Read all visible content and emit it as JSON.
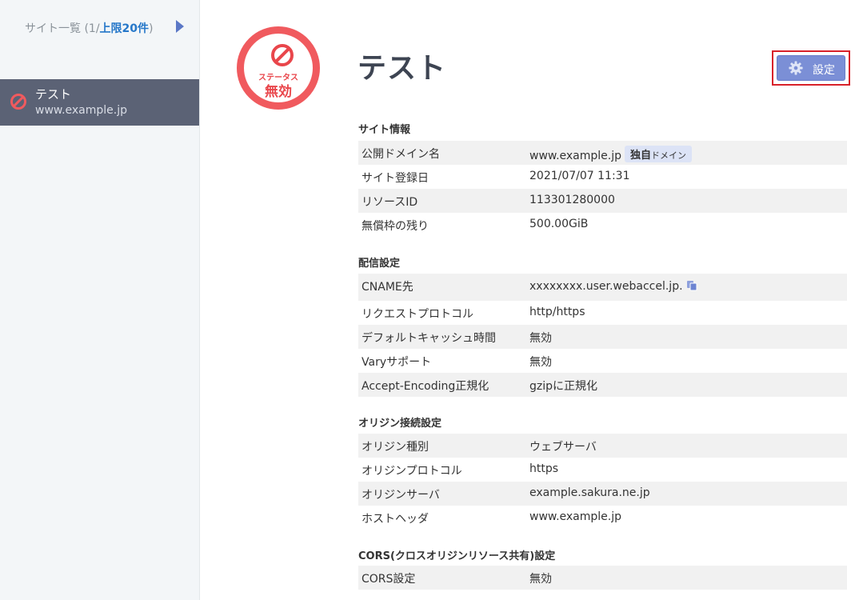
{
  "sidebar": {
    "count_prefix": "サイト一覧 (1/",
    "count_limit": "上限20件",
    "count_suffix": ")",
    "items": [
      {
        "name": "テスト",
        "domain": "www.example.jp",
        "status_icon": "ban-icon"
      }
    ]
  },
  "status": {
    "label": "ステータス",
    "value": "無効",
    "color": "#f05a5e"
  },
  "title": "テスト",
  "toolbar": {
    "settings_label": "設定",
    "settings_icon": "gear-icon"
  },
  "sections": {
    "site_info": {
      "title": "サイト情報",
      "rows": [
        {
          "key": "公開ドメイン名",
          "value": "www.example.jp",
          "badge_main": "独自",
          "badge_sub": "ドメイン"
        },
        {
          "key": "サイト登録日",
          "value": "2021/07/07 11:31"
        },
        {
          "key": "リソースID",
          "value": "113301280000"
        },
        {
          "key": "無償枠の残り",
          "value": "500.00GiB"
        }
      ]
    },
    "delivery": {
      "title": "配信設定",
      "rows": [
        {
          "key": "CNAME先",
          "value": "xxxxxxxx.user.webaccel.jp."
        },
        {
          "key": "リクエストプロトコル",
          "value": "http/https"
        },
        {
          "key": "デフォルトキャッシュ時間",
          "value": "無効"
        },
        {
          "key": "Varyサポート",
          "value": "無効"
        },
        {
          "key": "Accept-Encoding正規化",
          "value": "gzipに正規化"
        }
      ]
    },
    "origin": {
      "title": "オリジン接続設定",
      "rows": [
        {
          "key": "オリジン種別",
          "value": "ウェブサーバ"
        },
        {
          "key": "オリジンプロトコル",
          "value": "https"
        },
        {
          "key": "オリジンサーバ",
          "value": "example.sakura.ne.jp"
        },
        {
          "key": "ホストヘッダ",
          "value": "www.example.jp"
        }
      ]
    },
    "cors": {
      "title": "CORS(クロスオリジンリソース共有)設定",
      "rows": [
        {
          "key": "CORS設定",
          "value": "無効"
        }
      ]
    }
  }
}
